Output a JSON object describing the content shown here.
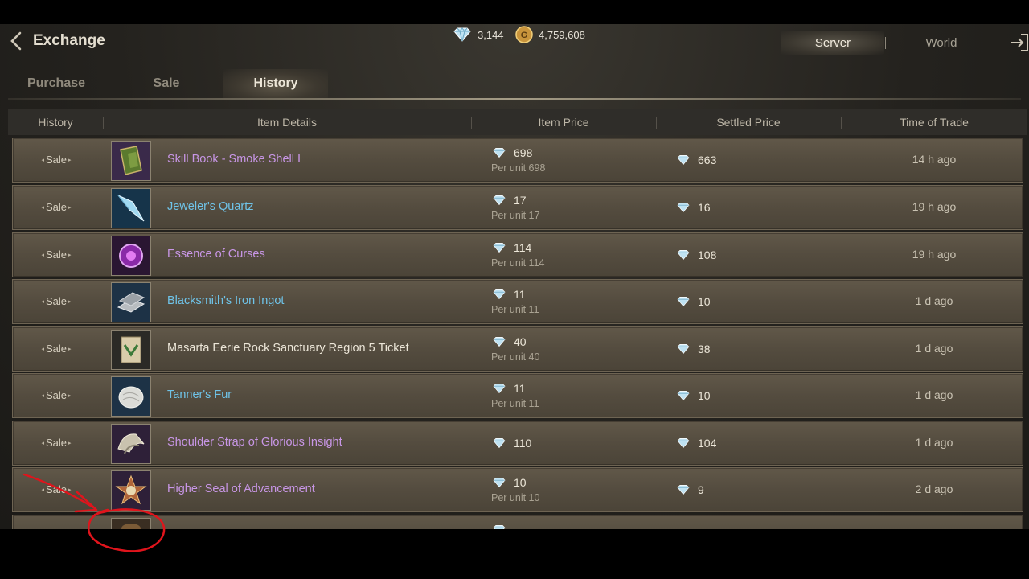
{
  "header": {
    "back_icon": "chevron-left-icon",
    "title": "Exchange",
    "diamonds": "3,144",
    "gold": "4,759,608",
    "scope_server": "Server",
    "scope_world": "World",
    "exit_icon": "exit-icon"
  },
  "tabs": [
    "Purchase",
    "Sale",
    "History"
  ],
  "active_tab": "History",
  "columns": [
    "History",
    "Item Details",
    "Item Price",
    "Settled Price",
    "Time of Trade"
  ],
  "rows": [
    {
      "history": "Sale",
      "name": "Skill Book - Smoke Shell I",
      "quality": "purple",
      "icon": "skill-book-icon",
      "price": "698",
      "per_unit": "Per unit  698",
      "settled": "663",
      "time": "14 h ago"
    },
    {
      "history": "Sale",
      "name": "Jeweler's Quartz",
      "quality": "blue",
      "icon": "quartz-icon",
      "price": "17",
      "per_unit": "Per unit  17",
      "settled": "16",
      "time": "19 h ago"
    },
    {
      "history": "Sale",
      "name": "Essence of Curses",
      "quality": "purple",
      "icon": "essence-orb-icon",
      "price": "114",
      "per_unit": "Per unit  114",
      "settled": "108",
      "time": "19 h ago"
    },
    {
      "history": "Sale",
      "name": "Blacksmith's Iron Ingot",
      "quality": "blue",
      "icon": "iron-ingot-icon",
      "price": "11",
      "per_unit": "Per unit  11",
      "settled": "10",
      "time": "1 d ago"
    },
    {
      "history": "Sale",
      "name": "Masarta Eerie Rock Sanctuary Region 5 Ticket",
      "quality": "white",
      "icon": "ticket-icon",
      "price": "40",
      "per_unit": "Per unit  40",
      "settled": "38",
      "time": "1 d ago"
    },
    {
      "history": "Sale",
      "name": "Tanner's Fur",
      "quality": "blue",
      "icon": "fur-icon",
      "price": "11",
      "per_unit": "Per unit  11",
      "settled": "10",
      "time": "1 d ago"
    },
    {
      "history": "Sale",
      "name": "Shoulder Strap of Glorious Insight",
      "quality": "purple",
      "icon": "shoulder-armor-icon",
      "price": "110",
      "per_unit": "",
      "settled": "104",
      "time": "1 d ago"
    },
    {
      "history": "Sale",
      "name": "Higher Seal of Advancement",
      "quality": "purple",
      "icon": "seal-icon",
      "price": "10",
      "per_unit": "Per unit  10",
      "settled": "9",
      "time": "2 d ago"
    },
    {
      "history": "",
      "name": "",
      "quality": "white",
      "icon": "partial-item-icon",
      "price": "",
      "per_unit": "",
      "settled": "",
      "time": ""
    }
  ],
  "colors": {
    "purple": "#c896e6",
    "blue": "#6fc3e8",
    "white": "#ece6d8",
    "annotation": "#e0141c"
  },
  "annotation": {
    "shape": "red-hand-drawn-arrow-and-circle",
    "target": "partial-row-item-icon"
  }
}
